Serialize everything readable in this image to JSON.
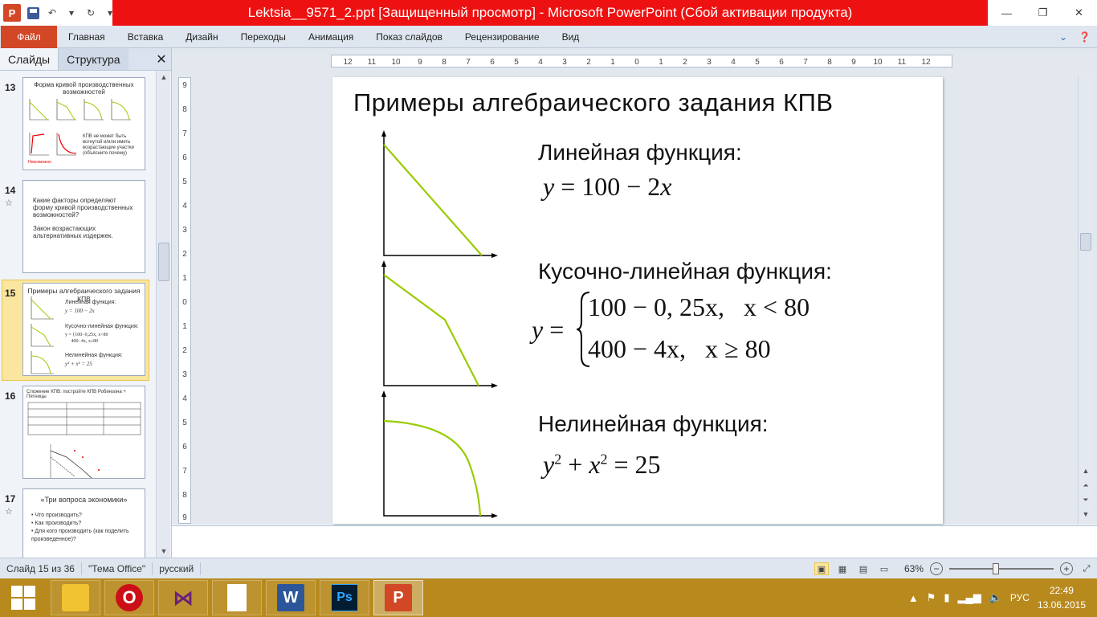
{
  "window": {
    "title": "Lektsia__9571_2.ppt [Защищенный просмотр] - Microsoft PowerPoint (Сбой активации продукта)"
  },
  "ribbon": {
    "file_tab": "Файл",
    "tabs": [
      "Главная",
      "Вставка",
      "Дизайн",
      "Переходы",
      "Анимация",
      "Показ слайдов",
      "Рецензирование",
      "Вид"
    ]
  },
  "panel": {
    "tabs": [
      "Слайды",
      "Структура"
    ]
  },
  "thumbnails": [
    {
      "number": "13",
      "title": "Форма кривой производственных возможностей",
      "note": "КПВ не может быть вогнутой и/или иметь возрастающие участки (объясните почему)",
      "bad_label": "Невозможно"
    },
    {
      "number": "14",
      "line1": "Какие факторы определяют форму кривой производственных возможностей?",
      "line2": "Закон возрастающих альтернативных издержек."
    },
    {
      "number": "15",
      "title": "Примеры алгебраического задания КПВ",
      "l1": "Линейная функция:",
      "f1": "y = 100 − 2x",
      "l2": "Кусочно-линейная функция:",
      "l3": "Нелинейная функция:",
      "f3": "y² + x² = 25"
    },
    {
      "number": "16",
      "title": "Сложение КПВ: постройте КПВ Робинзона + Пятницы"
    },
    {
      "number": "17",
      "title": "«Три вопроса экономики»",
      "items": [
        "Что производить?",
        "Как производить?",
        "Для кого производить (как поделить произведенное)?"
      ]
    }
  ],
  "slide": {
    "title": "Примеры алгебраического задания КПВ",
    "linear_label": "Линейная функция:",
    "linear_formula": {
      "y": "y",
      "eq": " = 100 − 2",
      "x": "x"
    },
    "piecewise_label": "Кусочно-линейная функция:",
    "piecewise": {
      "y": "y",
      "eq": " = ",
      "row1": "100 − 0, 25x,",
      "row1_cond": "x < 80",
      "row2": "400 − 4x,",
      "row2_cond": "x ≥ 80"
    },
    "nonlinear_label": "Нелинейная функция:",
    "nonlinear_formula": {
      "y": "y",
      "x": "x",
      "exp": "2",
      "rest": " = 25"
    },
    "curve_color": "#99cc00"
  },
  "status": {
    "slide_counter": "Слайд 15 из 36",
    "theme": "\"Тема Office\"",
    "language": "русский",
    "zoom": "63%"
  },
  "taskbar": {
    "tray_lang": "РУС",
    "time": "22:49",
    "date": "13.06.2015"
  },
  "colors": {
    "accent": "#d24726",
    "title_red": "#ee1111",
    "taskbar": "#b88a1e",
    "selection": "#fbe6a0"
  }
}
